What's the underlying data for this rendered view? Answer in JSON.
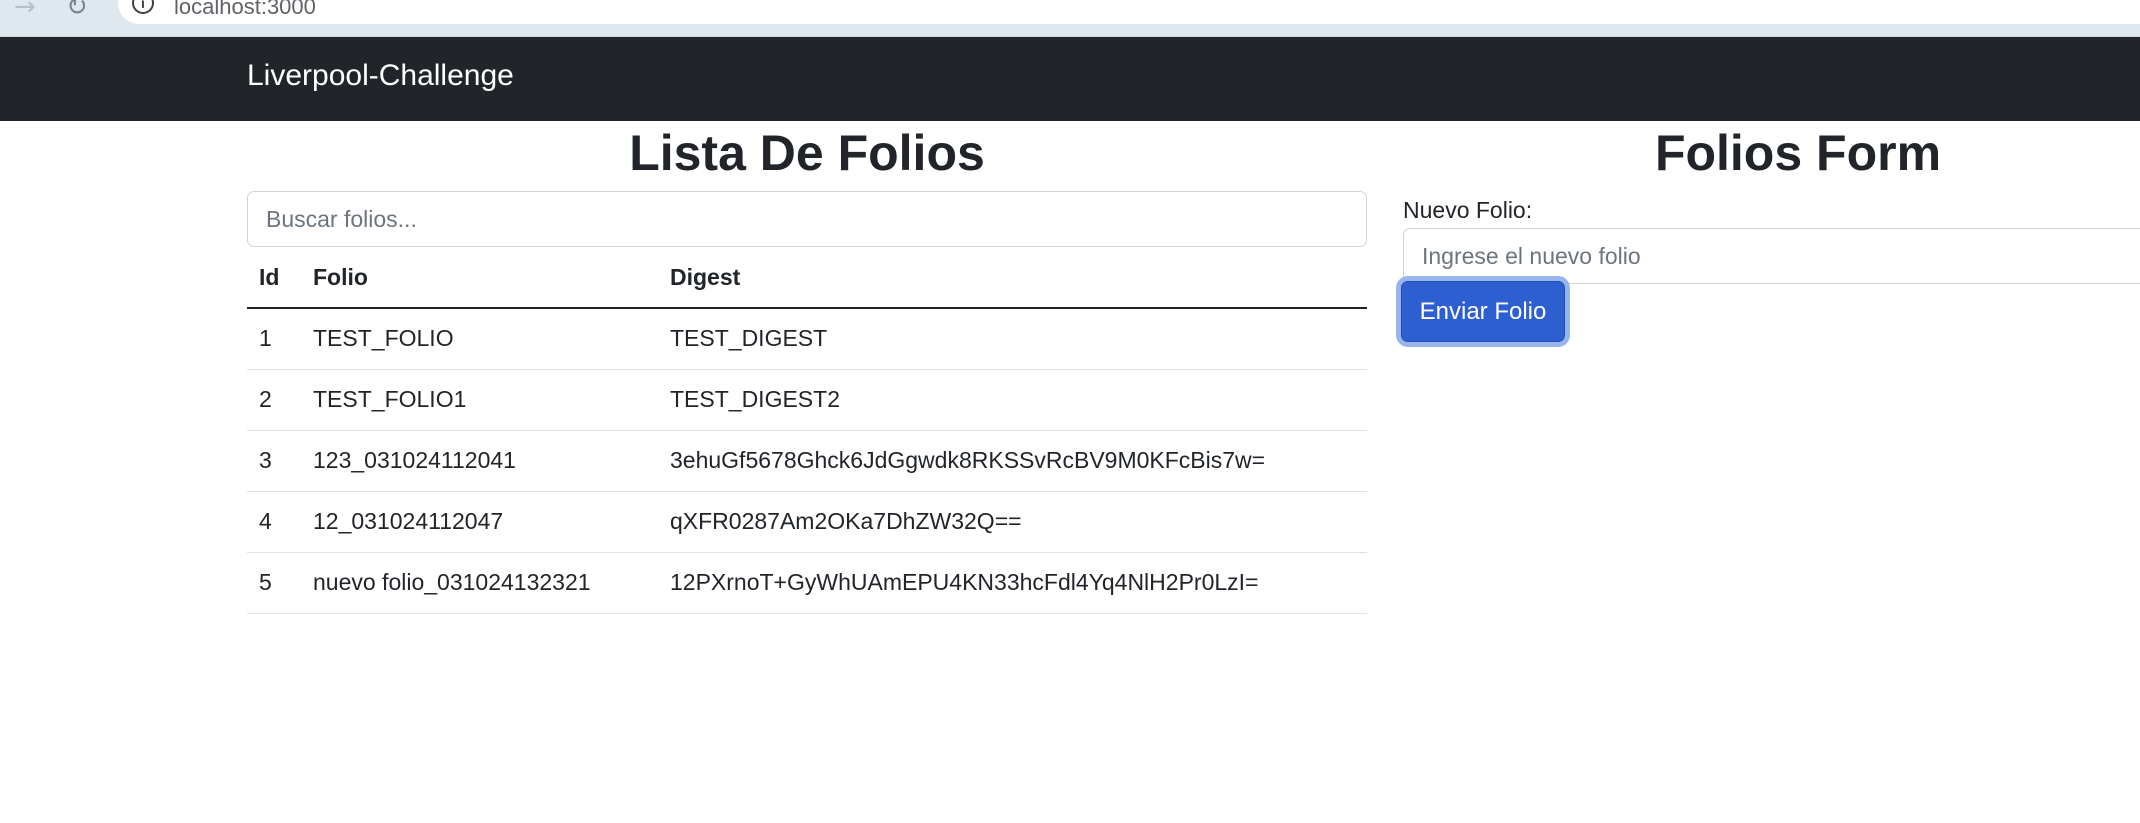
{
  "browser": {
    "forward_icon": "arrow-right-icon",
    "reload_icon": "reload-icon",
    "info_icon": "info-icon",
    "url": "localhost:3000"
  },
  "navbar": {
    "brand": "Liverpool-Challenge"
  },
  "list": {
    "title": "Lista De Folios",
    "search_placeholder": "Buscar folios...",
    "columns": [
      "Id",
      "Folio",
      "Digest"
    ],
    "rows": [
      {
        "id": "1",
        "folio": "TEST_FOLIO",
        "digest": "TEST_DIGEST"
      },
      {
        "id": "2",
        "folio": "TEST_FOLIO1",
        "digest": "TEST_DIGEST2"
      },
      {
        "id": "3",
        "folio": "123_031024112041",
        "digest": "3ehuGf5678Ghck6JdGgwdk8RKSSvRcBV9M0KFcBis7w="
      },
      {
        "id": "4",
        "folio": "12_031024112047",
        "digest": "qXFR0287Am2OKa7DhZW32Q=="
      },
      {
        "id": "5",
        "folio": "nuevo folio_031024132321",
        "digest": "12PXrnoT+GyWhUAmEPU4KN33hcFdl4Yq4NlH2Pr0LzI="
      }
    ]
  },
  "form": {
    "title": "Folios Form",
    "label": "Nuevo Folio:",
    "input_placeholder": "Ingrese el nuevo folio",
    "submit_label": "Enviar Folio"
  },
  "colors": {
    "navbar_bg": "#212529",
    "button_primary": "#2d5fd0",
    "button_focus_ring": "#98b4ec"
  }
}
